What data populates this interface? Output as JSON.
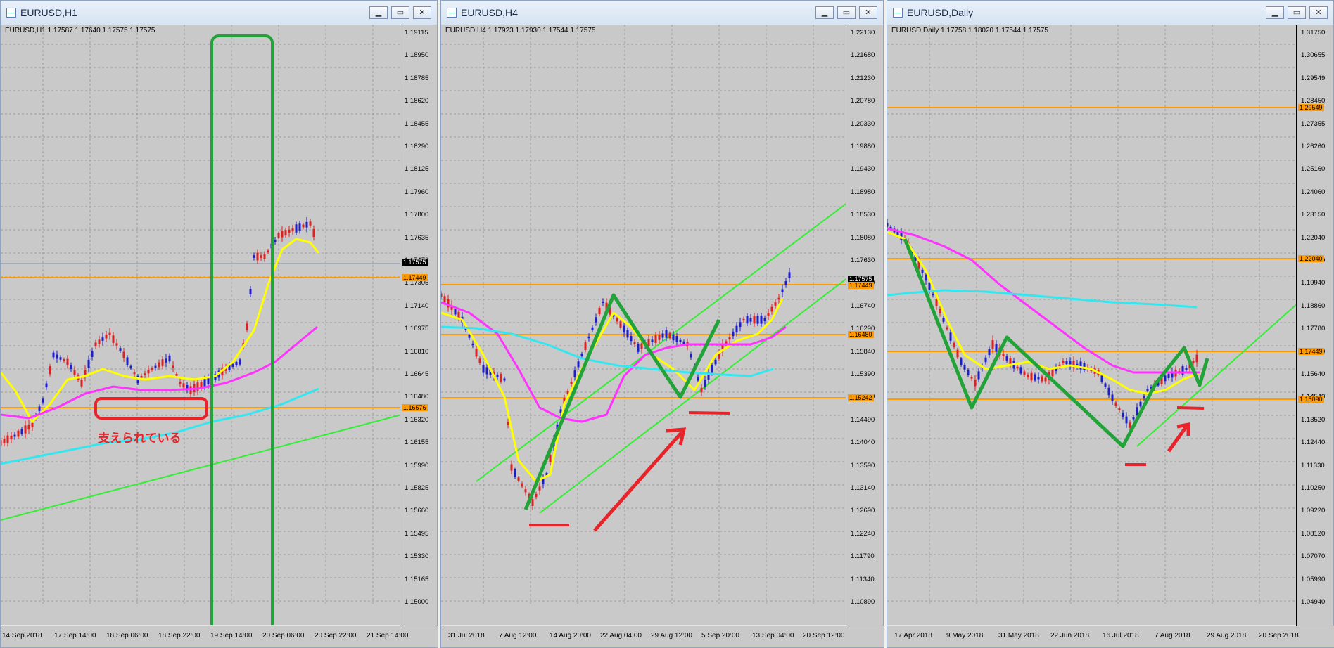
{
  "windows": [
    {
      "title": "EURUSD,H1",
      "info": "EURUSD,H1  1.17587 1.17640 1.17575 1.17575",
      "y_labels": [
        "1.19115",
        "1.18950",
        "1.18785",
        "1.18620",
        "1.18455",
        "1.18290",
        "1.18125",
        "1.17960",
        "1.17800",
        "1.17635",
        "1.17470",
        "1.17305",
        "1.17140",
        "1.16975",
        "1.16810",
        "1.16645",
        "1.16480",
        "1.16320",
        "1.16155",
        "1.15990",
        "1.15825",
        "1.15660",
        "1.15495",
        "1.15330",
        "1.15165",
        "1.15000"
      ],
      "price_tag": "1.17575",
      "level_tags": [
        "1.17449",
        "1.16576"
      ],
      "x_labels": [
        "14 Sep 2018",
        "17 Sep 14:00",
        "18 Sep 06:00",
        "18 Sep 22:00",
        "19 Sep 14:00",
        "20 Sep 06:00",
        "20 Sep 22:00",
        "21 Sep 14:00"
      ],
      "annotation": "支えられている",
      "colors": {
        "ma_fast": "#ffff00",
        "ma_mid": "#ff33ff",
        "ma_slow": "#33e6f0",
        "trend": "#33ee33",
        "level": "#ff9900",
        "mark": "#e8242a",
        "box": "#22a33a"
      }
    },
    {
      "title": "EURUSD,H4",
      "info": "EURUSD,H4  1.17923 1.17930 1.17544 1.17575",
      "y_labels": [
        "1.22130",
        "1.21680",
        "1.21230",
        "1.20780",
        "1.20330",
        "1.19880",
        "1.19430",
        "1.18980",
        "1.18530",
        "1.18080",
        "1.17630",
        "1.17190",
        "1.16740",
        "1.16290",
        "1.15840",
        "1.15390",
        "1.14940",
        "1.14490",
        "1.14040",
        "1.13590",
        "1.13140",
        "1.12690",
        "1.12240",
        "1.11790",
        "1.11340",
        "1.10890"
      ],
      "price_tag": "1.17575",
      "level_tags": [
        "1.17449",
        "1.16480",
        "1.15242"
      ],
      "x_labels": [
        "31 Jul 2018",
        "7 Aug 12:00",
        "14 Aug 20:00",
        "22 Aug 04:00",
        "29 Aug 12:00",
        "5 Sep 20:00",
        "13 Sep 04:00",
        "20 Sep 12:00"
      ]
    },
    {
      "title": "EURUSD,Daily",
      "info": "EURUSD,Daily  1.17758 1.18020 1.17544 1.17575",
      "y_labels": [
        "1.31750",
        "1.30655",
        "1.29549",
        "1.28450",
        "1.27355",
        "1.26260",
        "1.25160",
        "1.24060",
        "1.23150",
        "1.22040",
        "1.21050",
        "1.19940",
        "1.18860",
        "1.17780",
        "1.16730",
        "1.15640",
        "1.14540",
        "1.13520",
        "1.12440",
        "1.11330",
        "1.10250",
        "1.09220",
        "1.08120",
        "1.07070",
        "1.05990",
        "1.04940"
      ],
      "price_tag": "1.17575",
      "level_tags": [
        "1.29549",
        "1.22040",
        "1.17449",
        "1.15090"
      ],
      "x_labels": [
        "17 Apr 2018",
        "9 May 2018",
        "31 May 2018",
        "22 Jun 2018",
        "16 Jul 2018",
        "7 Aug 2018",
        "29 Aug 2018",
        "20 Sep 2018"
      ]
    }
  ]
}
